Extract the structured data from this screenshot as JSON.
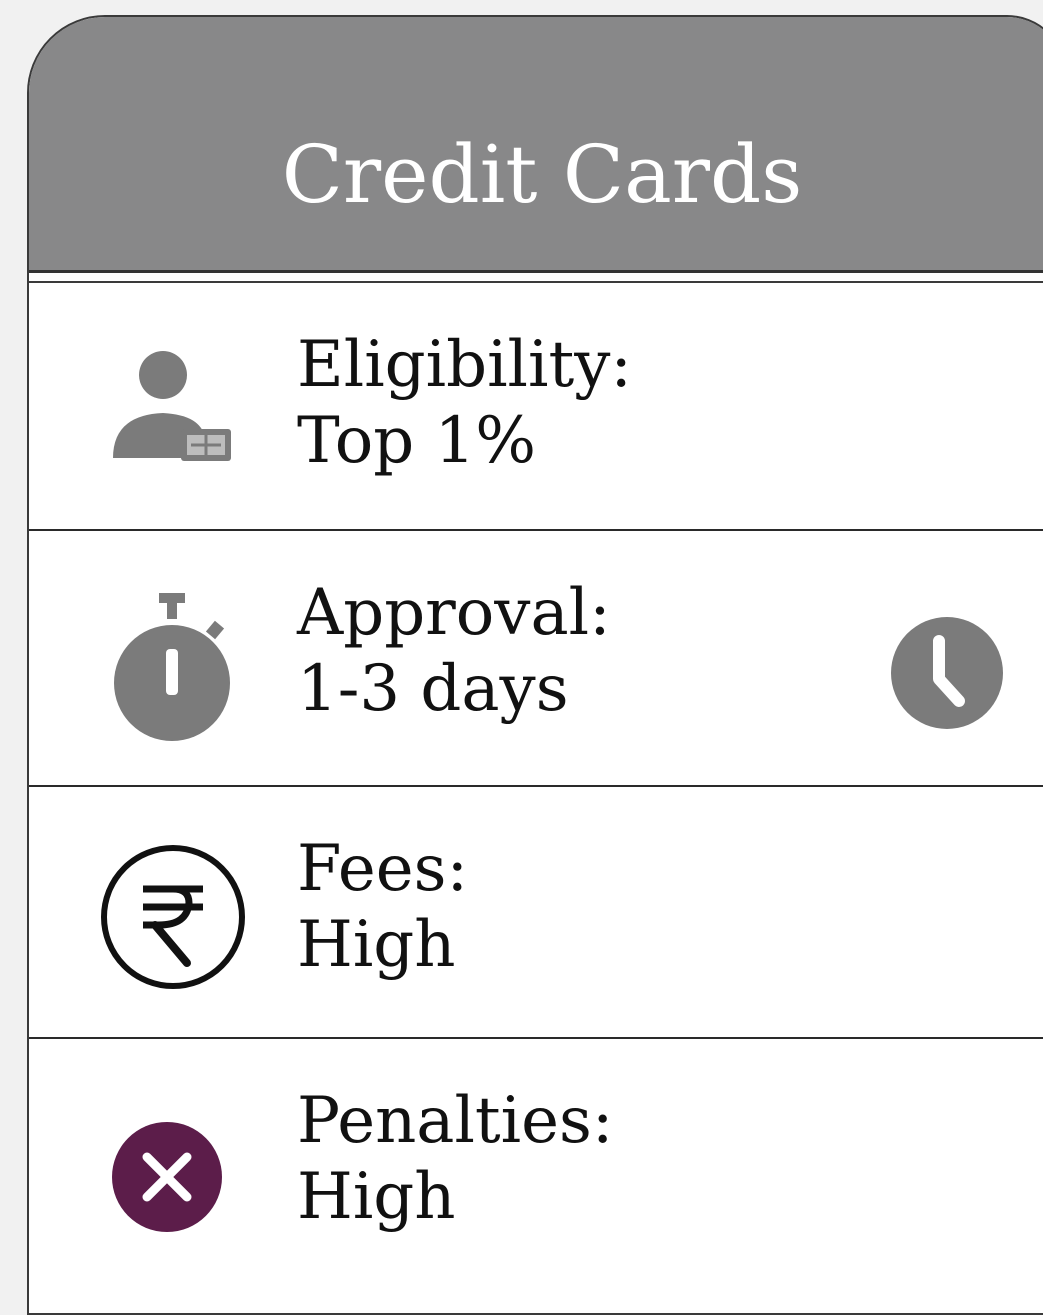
{
  "header": {
    "title": "Credit Cards"
  },
  "rows": [
    {
      "id": "eligibility",
      "label": "Eligibility:",
      "value": "Top 1%",
      "icon": "person-icon"
    },
    {
      "id": "approval",
      "label": "Approval:",
      "value": "1-3 days",
      "icon": "stopwatch-icon",
      "extra_icon": "clock-icon"
    },
    {
      "id": "fees",
      "label": "Fees:",
      "value": "High",
      "icon": "rupee-icon"
    },
    {
      "id": "penalties",
      "label": "Penalties:",
      "value": "High",
      "icon": "close-circle-icon",
      "icon_color": "#5c1d4a"
    }
  ],
  "colors": {
    "header_bg": "#888889",
    "icon_gray": "#7b7b7b",
    "penalty_icon": "#5c1d4a"
  }
}
